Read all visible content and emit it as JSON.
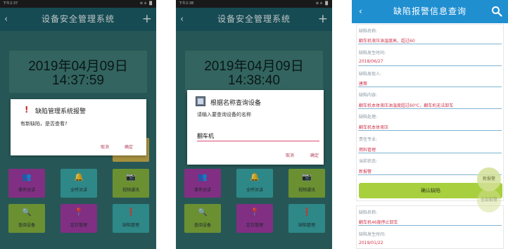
{
  "phone1": {
    "status": {
      "left": "下午2:37",
      "right": "⊕ ⋔ ▐▌"
    },
    "title": "设备安全管理系统",
    "back": "‹",
    "plus": "+",
    "clock": {
      "date": "2019年04月09日",
      "time": "14:37:59"
    },
    "tiles": [
      {
        "label": "事件对讲",
        "color": "purple",
        "icon": "👥"
      },
      {
        "label": "全呼对讲",
        "color": "teal",
        "icon": "🔔"
      },
      {
        "label": "视频通讯",
        "color": "green",
        "icon": "📷"
      },
      {
        "label": "查阅设备",
        "color": "green",
        "icon": "🔍"
      },
      {
        "label": "定位管理",
        "color": "purple",
        "icon": "📍"
      },
      {
        "label": "缺陷管理",
        "color": "teal",
        "icon": "❗"
      }
    ],
    "dialog": {
      "icon": "!",
      "title": "缺陷管理系统报警",
      "message": "有新缺陷，是否查看?",
      "cancel": "取消",
      "ok": "确定"
    }
  },
  "phone2": {
    "status": {
      "left": "下午2:38",
      "right": "⊕ ⋔ ▐▌"
    },
    "title": "设备安全管理系统",
    "back": "‹",
    "plus": "+",
    "clock": {
      "date": "2019年04月09日",
      "time": "14:38:40"
    },
    "tiles": [
      {
        "label": "事件对讲",
        "color": "purple",
        "icon": "👥"
      },
      {
        "label": "全呼对讲",
        "color": "teal",
        "icon": "🔔"
      },
      {
        "label": "视频通讯",
        "color": "green",
        "icon": "📷"
      },
      {
        "label": "查阅设备",
        "color": "green",
        "icon": "🔍"
      },
      {
        "label": "定位管理",
        "color": "purple",
        "icon": "📍"
      },
      {
        "label": "缺陷管理",
        "color": "teal",
        "icon": "❗"
      }
    ],
    "dialog": {
      "title": "根据名称查询设备",
      "message": "请输入要查询设备的名称",
      "input_value": "翻车机",
      "cancel": "取消",
      "ok": "确定"
    }
  },
  "phone3": {
    "title": "缺陷报警信息查询",
    "back": "‹",
    "fields": [
      {
        "label": "缺陷名称:",
        "value": "翻车机液压油温度高，超过60"
      },
      {
        "label": "缺陷发生时间:",
        "value": "2018/06/27"
      },
      {
        "label": "缺陷发现人:",
        "value": "唐策"
      },
      {
        "label": "缺陷内容:",
        "value": "翻车机本体液压油温度超过60℃，翻车机无法卸车"
      },
      {
        "label": "缺陷处理:",
        "value": "翻车机本体液压"
      },
      {
        "label": "责任专业:",
        "value": "燃料管理"
      },
      {
        "label": "当前状态:",
        "value": "新报警"
      }
    ],
    "confirm_button": "确认缺陷",
    "float_buttons": [
      "新报警",
      "全部报警"
    ],
    "fields2": [
      {
        "label": "缺陷名称:",
        "value": "翻车机46度停止卸车"
      },
      {
        "label": "缺陷发生时间:",
        "value": "2019/01/22"
      }
    ]
  },
  "colors": {
    "titlebar_dark": "#1c5c66",
    "titlebar_blue": "#1f8fd0",
    "purple": "#9d3aa0",
    "teal": "#3aa7a6",
    "green": "#83b03d",
    "confirm_green": "#a8cf3e",
    "value_red": "#d0344c"
  }
}
